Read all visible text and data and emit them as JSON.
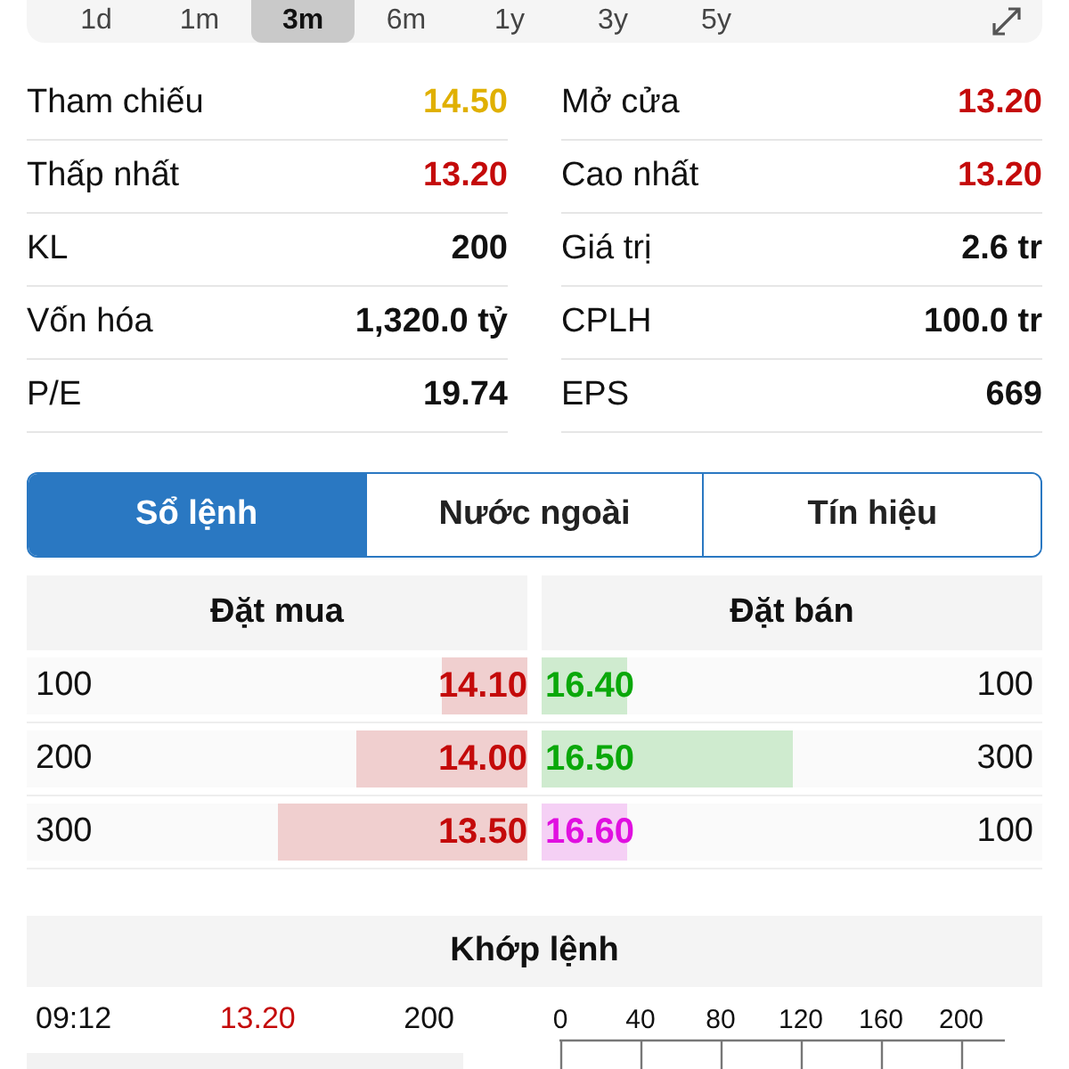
{
  "timeframes": [
    {
      "label": "1d",
      "selected": false
    },
    {
      "label": "1m",
      "selected": false
    },
    {
      "label": "3m",
      "selected": true
    },
    {
      "label": "6m",
      "selected": false
    },
    {
      "label": "1y",
      "selected": false
    },
    {
      "label": "3y",
      "selected": false
    },
    {
      "label": "5y",
      "selected": false
    }
  ],
  "stats": [
    {
      "label": "Tham chiếu",
      "value": "14.50",
      "color": "#e0b000"
    },
    {
      "label": "Mở cửa",
      "value": "13.20",
      "color": "#c40a0a"
    },
    {
      "label": "Thấp nhất",
      "value": "13.20",
      "color": "#c40a0a"
    },
    {
      "label": "Cao nhất",
      "value": "13.20",
      "color": "#c40a0a"
    },
    {
      "label": "KL",
      "value": "200",
      "color": "#111111"
    },
    {
      "label": "Giá trị",
      "value": "2.6 tr",
      "color": "#111111"
    },
    {
      "label": "Vốn hóa",
      "value": "1,320.0 tỷ",
      "color": "#111111"
    },
    {
      "label": "CPLH",
      "value": "100.0 tr",
      "color": "#111111"
    },
    {
      "label": "P/E",
      "value": "19.74",
      "color": "#111111"
    },
    {
      "label": "EPS",
      "value": "669",
      "color": "#111111"
    }
  ],
  "tabs": [
    {
      "label": "Sổ lệnh",
      "selected": true
    },
    {
      "label": "Nước ngoài",
      "selected": false
    },
    {
      "label": "Tín hiệu",
      "selected": false
    }
  ],
  "order_book": {
    "buy_header": "Đặt mua",
    "sell_header": "Đặt bán",
    "rows": [
      {
        "buy": {
          "volume": "100",
          "price": "14.10",
          "color": "#c40a0a",
          "level": 0.17
        },
        "sell": {
          "price": "16.40",
          "color": "#0aa80a",
          "level": 0.17,
          "volume": "100"
        }
      },
      {
        "buy": {
          "volume": "200",
          "price": "14.00",
          "color": "#c40a0a",
          "level": 0.34
        },
        "sell": {
          "price": "16.50",
          "color": "#0aa80a",
          "level": 0.5,
          "volume": "300"
        }
      },
      {
        "buy": {
          "volume": "300",
          "price": "13.50",
          "color": "#c40a0a",
          "level": 0.5
        },
        "sell": {
          "price": "16.60",
          "color": "#e010e0",
          "level": 0.17,
          "volume": "100"
        }
      }
    ]
  },
  "matches": {
    "title": "Khớp lệnh",
    "rows": [
      {
        "time": "09:12",
        "price": "13.20",
        "color": "#c40a0a",
        "volume": "200"
      }
    ],
    "axis_ticks": [
      "0",
      "40",
      "80",
      "120",
      "160",
      "200"
    ]
  }
}
